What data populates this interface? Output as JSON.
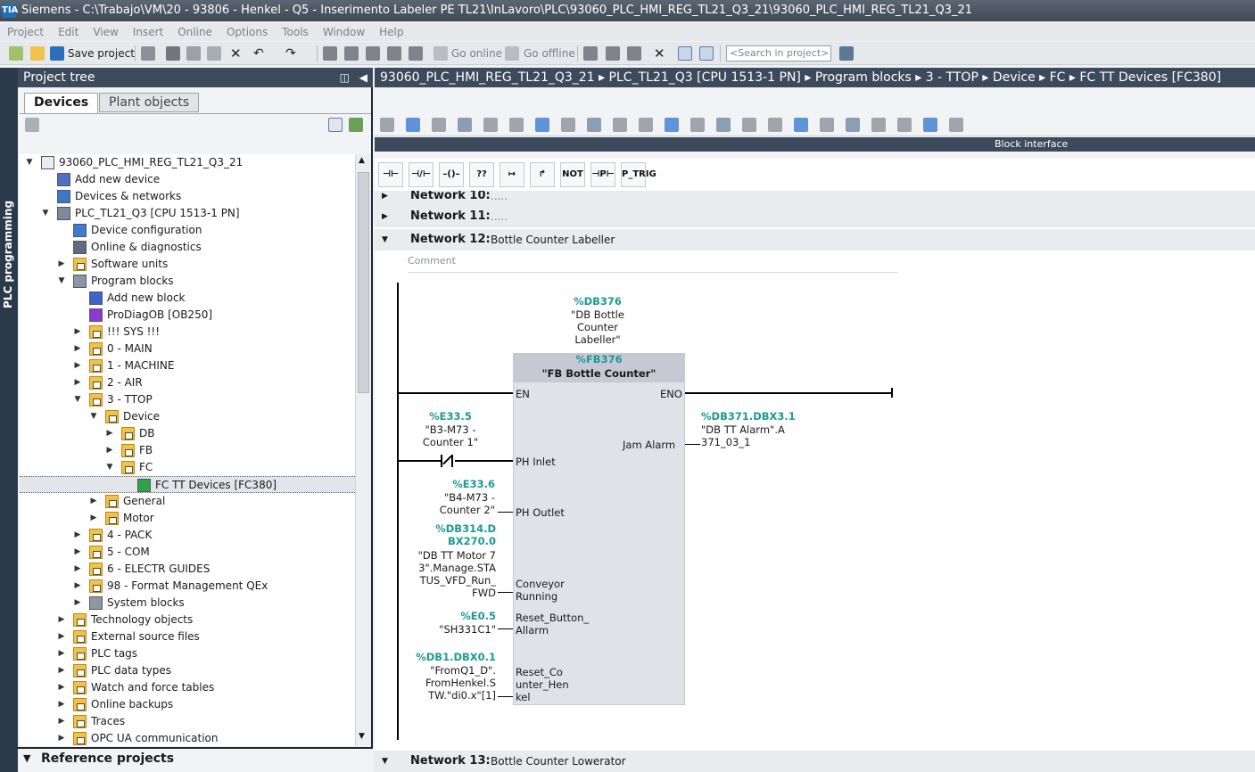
{
  "window": {
    "title": "Siemens  -  C:\\Trabajo\\VM\\20 - 93806 - Henkel - Q5 - Inserimento Labeler PE TL21\\InLavoro\\PLC\\93060_PLC_HMI_REG_TL21_Q3_21\\93060_PLC_HMI_REG_TL21_Q3_21",
    "logo": "TIA"
  },
  "menu": [
    "Project",
    "Edit",
    "View",
    "Insert",
    "Online",
    "Options",
    "Tools",
    "Window",
    "Help"
  ],
  "toolbar": {
    "save_label": "Save project",
    "go_online": "Go online",
    "go_offline": "Go offline",
    "search_placeholder": "<Search in project>"
  },
  "sidestrip": {
    "label": "PLC programming"
  },
  "project_tree": {
    "title": "Project tree",
    "tabs": [
      "Devices",
      "Plant objects"
    ],
    "items": [
      {
        "label": "93060_PLC_HMI_REG_TL21_Q3_21",
        "level": 0,
        "arrow": "open",
        "icon": "project-icon"
      },
      {
        "label": "Add new device",
        "level": 1,
        "arrow": "none",
        "icon": "add-device-icon"
      },
      {
        "label": "Devices & networks",
        "level": 1,
        "arrow": "none",
        "icon": "network-icon"
      },
      {
        "label": "PLC_TL21_Q3 [CPU 1513-1 PN]",
        "level": 1,
        "arrow": "open",
        "icon": "plc-icon"
      },
      {
        "label": "Device configuration",
        "level": 2,
        "arrow": "none",
        "icon": "device-config-icon"
      },
      {
        "label": "Online & diagnostics",
        "level": 2,
        "arrow": "none",
        "icon": "diagnostics-icon"
      },
      {
        "label": "Software units",
        "level": 2,
        "arrow": "closed",
        "icon": "folder-icon"
      },
      {
        "label": "Program blocks",
        "level": 2,
        "arrow": "open",
        "icon": "program-blocks-icon"
      },
      {
        "label": "Add new block",
        "level": 3,
        "arrow": "none",
        "icon": "add-block-icon"
      },
      {
        "label": "ProDiagOB [OB250]",
        "level": 3,
        "arrow": "none",
        "icon": "ob-icon"
      },
      {
        "label": "!!! SYS !!!",
        "level": 3,
        "arrow": "closed",
        "icon": "folder-icon"
      },
      {
        "label": "0 - MAIN",
        "level": 3,
        "arrow": "closed",
        "icon": "folder-icon"
      },
      {
        "label": "1 - MACHINE",
        "level": 3,
        "arrow": "closed",
        "icon": "folder-icon"
      },
      {
        "label": "2 - AIR",
        "level": 3,
        "arrow": "closed",
        "icon": "folder-icon"
      },
      {
        "label": "3 - TTOP",
        "level": 3,
        "arrow": "open",
        "icon": "folder-icon"
      },
      {
        "label": "Device",
        "level": 4,
        "arrow": "open",
        "icon": "folder-icon"
      },
      {
        "label": "DB",
        "level": 5,
        "arrow": "closed",
        "icon": "folder-icon"
      },
      {
        "label": "FB",
        "level": 5,
        "arrow": "closed",
        "icon": "folder-icon"
      },
      {
        "label": "FC",
        "level": 5,
        "arrow": "open",
        "icon": "folder-icon"
      },
      {
        "label": "FC TT Devices [FC380]",
        "level": 6,
        "arrow": "none",
        "icon": "fc-icon",
        "selected": true
      },
      {
        "label": "General",
        "level": 4,
        "arrow": "closed",
        "icon": "folder-icon"
      },
      {
        "label": "Motor",
        "level": 4,
        "arrow": "closed",
        "icon": "folder-icon"
      },
      {
        "label": "4 - PACK",
        "level": 3,
        "arrow": "closed",
        "icon": "folder-icon"
      },
      {
        "label": "5 - COM",
        "level": 3,
        "arrow": "closed",
        "icon": "folder-icon"
      },
      {
        "label": "6 - ELECTR GUIDES",
        "level": 3,
        "arrow": "closed",
        "icon": "folder-icon"
      },
      {
        "label": "98 - Format Management QEx",
        "level": 3,
        "arrow": "closed",
        "icon": "folder-icon"
      },
      {
        "label": "System blocks",
        "level": 3,
        "arrow": "closed",
        "icon": "system-blocks-icon"
      },
      {
        "label": "Technology objects",
        "level": 2,
        "arrow": "closed",
        "icon": "folder-icon"
      },
      {
        "label": "External source files",
        "level": 2,
        "arrow": "closed",
        "icon": "folder-icon"
      },
      {
        "label": "PLC tags",
        "level": 2,
        "arrow": "closed",
        "icon": "folder-icon"
      },
      {
        "label": "PLC data types",
        "level": 2,
        "arrow": "closed",
        "icon": "folder-icon"
      },
      {
        "label": "Watch and force tables",
        "level": 2,
        "arrow": "closed",
        "icon": "folder-icon"
      },
      {
        "label": "Online backups",
        "level": 2,
        "arrow": "closed",
        "icon": "folder-icon"
      },
      {
        "label": "Traces",
        "level": 2,
        "arrow": "closed",
        "icon": "folder-icon"
      },
      {
        "label": "OPC UA communication",
        "level": 2,
        "arrow": "closed",
        "icon": "folder-icon"
      }
    ],
    "reference_projects": "Reference projects"
  },
  "breadcrumb": "93060_PLC_HMI_REG_TL21_Q3_21  ▸  PLC_TL21_Q3 [CPU 1513-1 PN]  ▸  Program blocks  ▸  3 - TTOP  ▸  Device  ▸  FC  ▸  FC TT Devices [FC380]",
  "block_interface": "Block interface",
  "lad_buttons": [
    "⊣⊢",
    "⊣/⊢",
    "–()–",
    "??",
    "↦",
    "↱",
    "NOT",
    "⊣P⊢",
    "P_TRIG"
  ],
  "networks": [
    {
      "number": "Network 10:",
      "title": "....."
    },
    {
      "number": "Network 11:",
      "title": "....."
    },
    {
      "number": "Network 12:",
      "title": "Bottle Counter Labeller"
    },
    {
      "number": "Network 13:",
      "title": "Bottle Counter Lowerator"
    }
  ],
  "network12": {
    "comment": "Comment",
    "instance_db_addr": "%DB376",
    "instance_db_name": "\"DB Bottle Counter Labeller\"",
    "fb_addr": "%FB376",
    "fb_name": "\"FB Bottle Counter\"",
    "en": "EN",
    "eno": "ENO",
    "inputs": [
      {
        "addr": "%E33.5",
        "name": "\"B3-M73 - Counter 1\"",
        "pin": "PH Inlet"
      },
      {
        "addr": "%E33.6",
        "name": "\"B4-M73 - Counter 2\"",
        "pin": "PH Outlet"
      },
      {
        "addr": "%DB314.DBX270.0",
        "name": "\"DB TT Motor 73\".Manage.STATUS_VFD_Run_FWD",
        "pin": "Conveyor Running"
      },
      {
        "addr": "%E0.5",
        "name": "\"SH331C1\"",
        "pin": "Reset_Button_Allarm"
      },
      {
        "addr": "%DB1.DBX0.1",
        "name": "\"FromQ1_D\".FromHenkel.STW.\"di0.x\"[1]",
        "pin": "Reset_Counter_Henkel"
      }
    ],
    "output": {
      "addr": "%DB371.DBX3.1",
      "name": "\"DB TT Alarm\".A371_03_1",
      "pin": "Jam Alarm"
    }
  }
}
